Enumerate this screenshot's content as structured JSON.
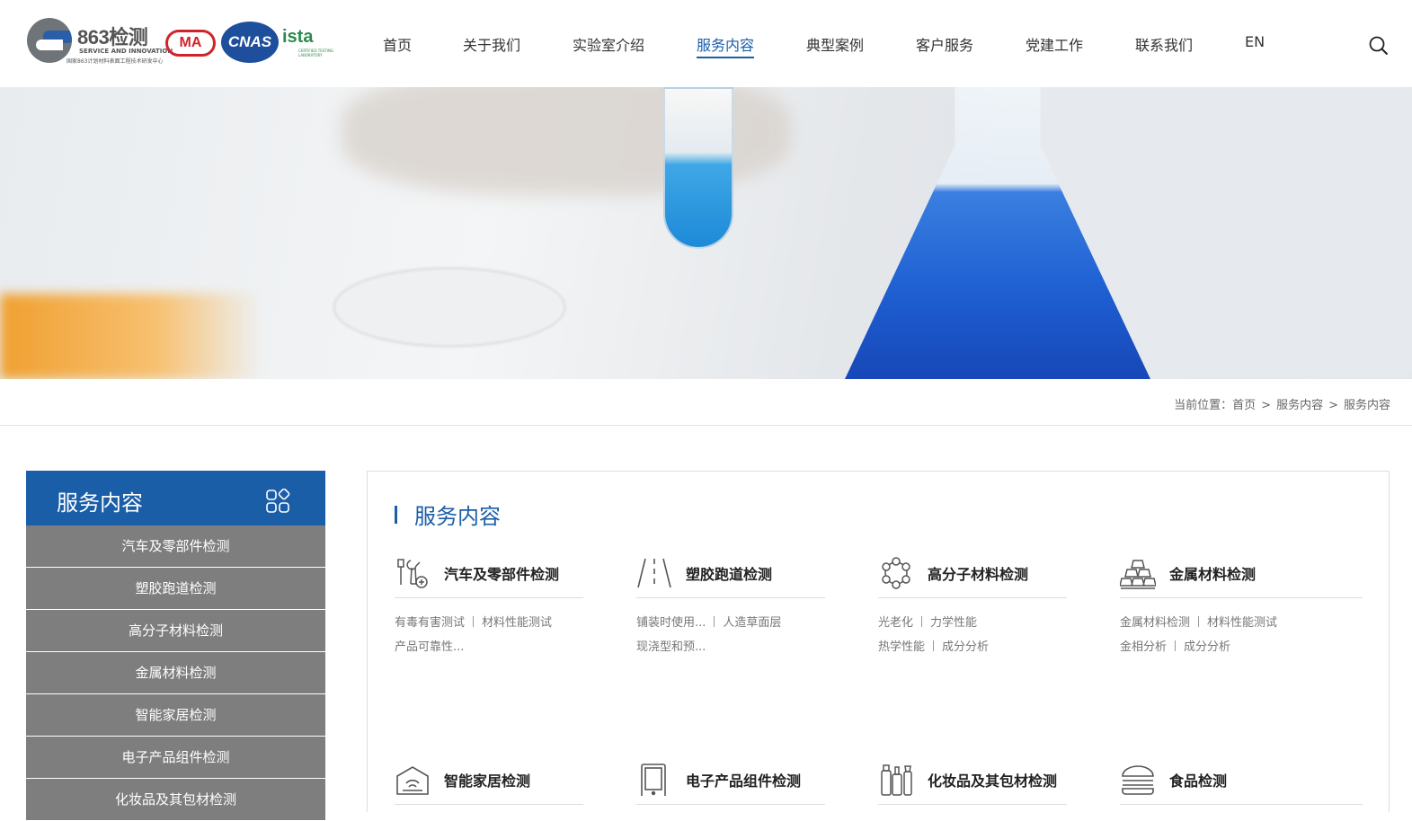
{
  "header": {
    "logo_title": "863检测",
    "logo_sub": "SERVICE AND INNOVATION",
    "logo_sub2": "国家863计划材料表面工程技术研发中心",
    "cert_ma": "MA",
    "cert_cnas": "CNAS",
    "cert_ista": "ista",
    "cert_ista_sub": "CERTIFIED TESTING LABORATORY",
    "nav": [
      "首页",
      "关于我们",
      "实验室介绍",
      "服务内容",
      "典型案例",
      "客户服务",
      "党建工作",
      "联系我们",
      "EN"
    ],
    "active_nav": "服务内容"
  },
  "breadcrumb": {
    "prefix": "当前位置：",
    "items": [
      "首页",
      "服务内容",
      "服务内容"
    ],
    "separator": ">"
  },
  "sidebar": {
    "title": "服务内容",
    "items": [
      "汽车及零部件检测",
      "塑胶跑道检测",
      "高分子材料检测",
      "金属材料检测",
      "智能家居检测",
      "电子产品组件检测",
      "化妆品及其包材检测"
    ]
  },
  "main": {
    "title": "服务内容",
    "cards": [
      {
        "title": "汽车及零部件检测",
        "icon": "wrench-tools-icon",
        "tags": [
          [
            "有毒有害测试",
            "材料性能测试"
          ],
          [
            "产品可靠性..."
          ]
        ]
      },
      {
        "title": "塑胶跑道检测",
        "icon": "road-lanes-icon",
        "tags": [
          [
            "铺装时使用...",
            "人造草面层"
          ],
          [
            "现浇型和预..."
          ]
        ]
      },
      {
        "title": "高分子材料检测",
        "icon": "molecule-ring-icon",
        "tags": [
          [
            "光老化",
            "力学性能"
          ],
          [
            "热学性能",
            "成分分析"
          ]
        ]
      },
      {
        "title": "金属材料检测",
        "icon": "metal-ingots-icon",
        "tags": [
          [
            "金属材料检测",
            "材料性能测试"
          ],
          [
            "金相分析",
            "成分分析"
          ]
        ]
      },
      {
        "title": "智能家居检测",
        "icon": "smart-home-icon",
        "tags": []
      },
      {
        "title": "电子产品组件检测",
        "icon": "device-icon",
        "tags": []
      },
      {
        "title": "化妆品及其包材检测",
        "icon": "cosmetics-bottles-icon",
        "tags": []
      },
      {
        "title": "食品检测",
        "icon": "burger-icon",
        "tags": []
      }
    ]
  },
  "colors": {
    "primary_blue": "#1a5ea8",
    "sidebar_gray": "#7e7e7e"
  }
}
